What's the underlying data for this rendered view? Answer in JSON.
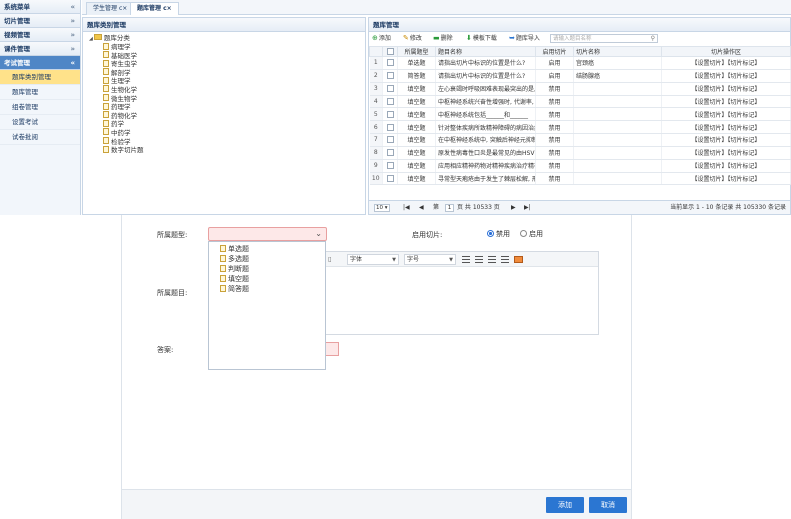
{
  "nav": {
    "sections": [
      {
        "label": "系统菜单",
        "chev": "«"
      },
      {
        "label": "切片管理",
        "chev": "»"
      },
      {
        "label": "视频管理",
        "chev": "»"
      },
      {
        "label": "课件管理",
        "chev": "»"
      },
      {
        "label": "考试管理",
        "chev": "«"
      }
    ],
    "items": [
      "题库类别管理",
      "题库管理",
      "组卷管理",
      "设置考试",
      "试卷批阅"
    ]
  },
  "tabs": [
    {
      "label": "学生管理",
      "close": "c×"
    },
    {
      "label": "题库管理",
      "close": "c×"
    }
  ],
  "tree": {
    "title": "题库类别管理",
    "root": "题库分类",
    "children": [
      "病理学",
      "基础医学",
      "寄生虫学",
      "解剖学",
      "生理学",
      "生物化学",
      "微生物学",
      "药理学",
      "药物化学",
      "药学",
      "中药学",
      "检验学",
      "数字切片题"
    ]
  },
  "grid": {
    "title": "题库管理",
    "toolbar": {
      "add": "添加",
      "edit": "修改",
      "delete": "删除",
      "template": "模板下载",
      "import": "题库导入",
      "search_placeholder": "请输入题目名称"
    },
    "columns": [
      "所属题型",
      "题目名称",
      "启用切片",
      "切片名称",
      "切片操作区"
    ],
    "rows": [
      {
        "n": "1",
        "type": "单选题",
        "name": "请指出切片中标识的位置是什么?",
        "status": "启用",
        "slide": "宫颈癌",
        "ops": "【设置切片】【切片标记】"
      },
      {
        "n": "2",
        "type": "简答题",
        "name": "请指出切片中标识的位置是什么?",
        "status": "启用",
        "slide": "结肠腺癌",
        "ops": "【设置切片】【切片标记】"
      },
      {
        "n": "3",
        "type": "填空题",
        "name": "左心衰竭时呼吸困难表现最突出的是,",
        "status": "禁用",
        "slide": "",
        "ops": "【设置切片】【切片标记】"
      },
      {
        "n": "4",
        "type": "填空题",
        "name": "中枢神经系统兴奋性增强时, 代谢率,",
        "status": "禁用",
        "slide": "",
        "ops": "【设置切片】【切片标记】"
      },
      {
        "n": "5",
        "type": "填空题",
        "name": "中枢神经系统包括______和______",
        "status": "禁用",
        "slide": "",
        "ops": "【设置切片】【切片标记】"
      },
      {
        "n": "6",
        "type": "填空题",
        "name": "针对整体疾病所致精神障碍的病因治疗",
        "status": "禁用",
        "slide": "",
        "ops": "【设置切片】【切片标记】"
      },
      {
        "n": "7",
        "type": "填空题",
        "name": "在中枢神经系统中, 突触后神经元抑制",
        "status": "禁用",
        "slide": "",
        "ops": "【设置切片】【切片标记】"
      },
      {
        "n": "8",
        "type": "填空题",
        "name": "原发性病毒性口炎是最常见的由HSV",
        "status": "禁用",
        "slide": "",
        "ops": "【设置切片】【切片标记】"
      },
      {
        "n": "9",
        "type": "填空题",
        "name": "应用相应精神药物对精神疾病治疗精神",
        "status": "禁用",
        "slide": "",
        "ops": "【设置切片】【切片标记】"
      },
      {
        "n": "10",
        "type": "填空题",
        "name": "寻常型天疱疮由于发生了棘层松解, 形",
        "status": "禁用",
        "slide": "",
        "ops": "【设置切片】【切片标记】"
      }
    ],
    "pager": {
      "size": "10",
      "page_label": "第",
      "page": "1",
      "total": "页 共 10533 页",
      "info": "当前显示 1 - 10 条记录 共 105330 条记录"
    }
  },
  "modal": {
    "type_label": "所属题型:",
    "slide_label": "启用切片:",
    "radio_off": "禁用",
    "radio_on": "启用",
    "question_label": "所属题目:",
    "answer_label": "答案:",
    "editor": {
      "font": "字体",
      "size": "字号"
    },
    "dropdown": [
      "单选题",
      "多选题",
      "判断题",
      "填空题",
      "简答题"
    ],
    "add_button": "添加",
    "cancel_button": "取消"
  }
}
